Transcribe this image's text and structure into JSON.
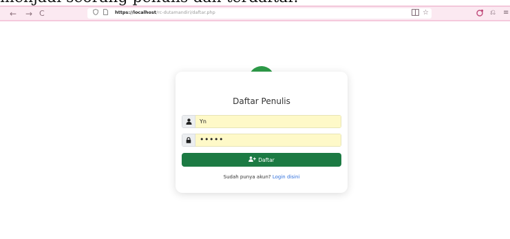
{
  "caption": "menjadi seorang penulis dan terdaftar.",
  "browser": {
    "back_glyph": "←",
    "forward_glyph": "→",
    "reload_glyph": "C",
    "url_host": "https://localhost",
    "url_path": "/rc-dutamandiri/daftar.php",
    "url_display": "http://localhost/rc-dutamandiri/daftar.php"
  },
  "form": {
    "title": "Daftar Penulis",
    "username_value": "Yn",
    "password_value": "•••••",
    "submit_label": "Daftar",
    "footer_text": "Sudah punya akun?",
    "footer_link": "Login disini"
  },
  "colors": {
    "badge": "#2e9c49",
    "button": "#1c7a43",
    "input_bg": "#fef9c8",
    "toolbar_bg": "#fbe9f1",
    "link": "#2f6fdc"
  },
  "icons": {
    "badge": "user-edit-icon",
    "username": "user-icon",
    "password": "lock-icon",
    "submit": "user-plus-icon"
  }
}
